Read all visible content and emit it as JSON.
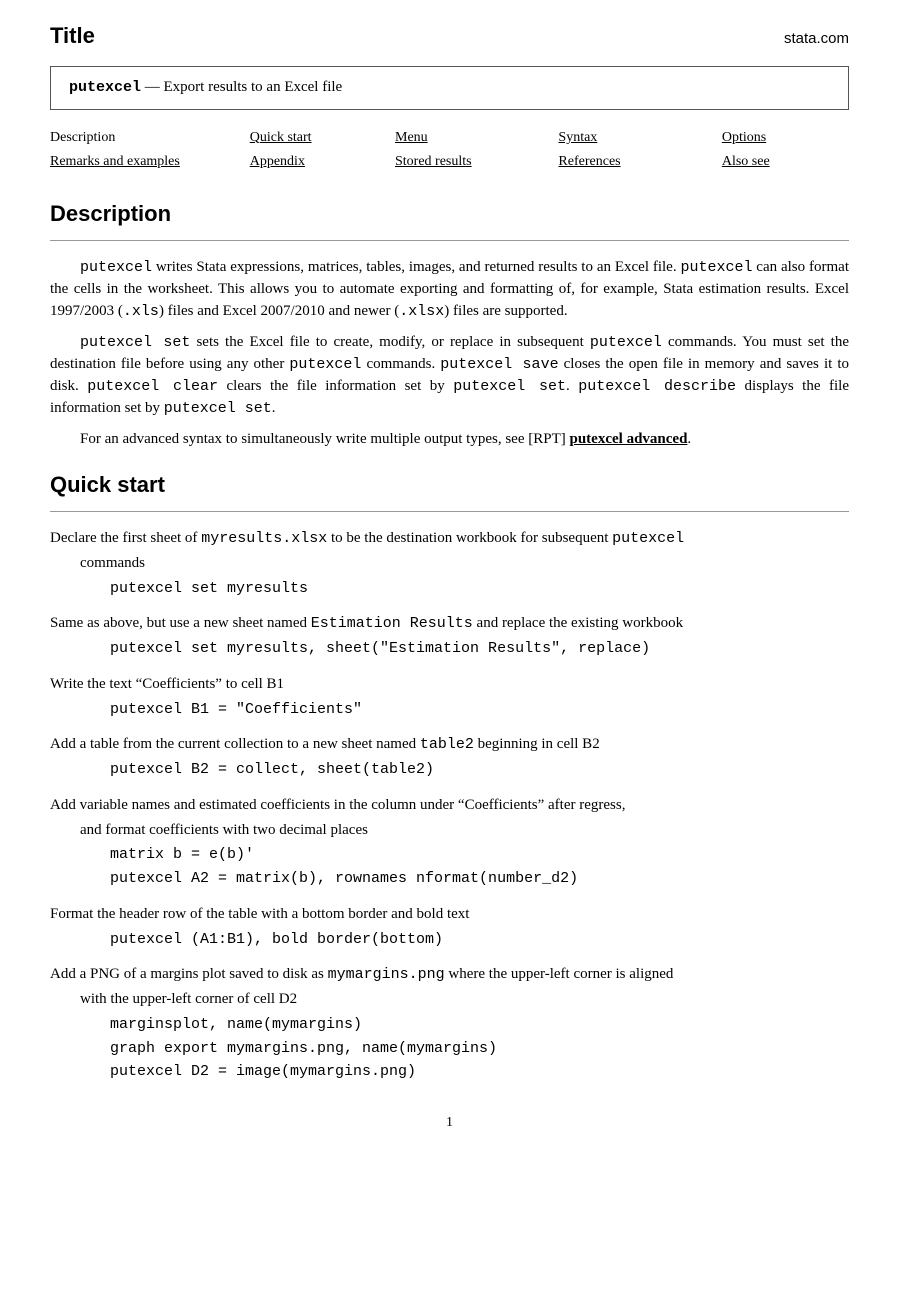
{
  "title": {
    "text": "Title",
    "stata_com": "stata.com"
  },
  "command_box": {
    "command": "putexcel",
    "separator": " — ",
    "description": "Export results to an Excel file"
  },
  "nav": {
    "row1": [
      {
        "label": "Description",
        "link": false
      },
      {
        "label": "Quick start",
        "link": true
      },
      {
        "label": "Menu",
        "link": true
      },
      {
        "label": "Syntax",
        "link": true
      },
      {
        "label": "Options",
        "link": true
      }
    ],
    "row2": [
      {
        "label": "Remarks and examples",
        "link": true
      },
      {
        "label": "Appendix",
        "link": true
      },
      {
        "label": "Stored results",
        "link": true
      },
      {
        "label": "References",
        "link": true
      },
      {
        "label": "Also see",
        "link": true
      }
    ]
  },
  "description_section": {
    "heading": "Description",
    "para1": "putexcel writes Stata expressions, matrices, tables, images, and returned results to an Excel file. putexcel can also format the cells in the worksheet. This allows you to automate exporting and formatting of, for example, Stata estimation results. Excel 1997/2003 (.xls) files and Excel 2007/2010 and newer (.xlsx) files are supported.",
    "para2_prefix": "putexcel set sets the Excel file to create, modify, or replace in subsequent putexcel commands. You must set the destination file before using any other putexcel commands. putexcel save closes the open file in memory and saves it to disk. putexcel clear clears the file information set by putexcel set. putexcel describe displays the file information set by putexcel set.",
    "para3_prefix": "For an advanced syntax to simultaneously write multiple output types, see [RPT] ",
    "para3_link": "putexcel advanced",
    "para3_suffix": "."
  },
  "quickstart_section": {
    "heading": "Quick start",
    "items": [
      {
        "desc": "Declare the first sheet of myresults.xlsx to be the destination workbook for subsequent putexcel commands",
        "desc_cont": null,
        "codes": [
          "putexcel set myresults"
        ]
      },
      {
        "desc": "Same as above, but use a new sheet named Estimation Results and replace the existing workbook",
        "desc_cont": null,
        "codes": [
          "putexcel set myresults, sheet(\"Estimation Results\", replace)"
        ]
      },
      {
        "desc": "Write the text “Coefficients” to cell B1",
        "desc_cont": null,
        "codes": [
          "putexcel B1 = \"Coefficients\""
        ]
      },
      {
        "desc": "Add a table from the current collection to a new sheet named table2 beginning in cell B2",
        "desc_cont": null,
        "codes": [
          "putexcel B2 = collect, sheet(table2)"
        ]
      },
      {
        "desc": "Add variable names and estimated coefficients in the column under “Coefficients” after regress, and format coefficients with two decimal places",
        "desc_cont": null,
        "codes": [
          "matrix b = e(b)'",
          "putexcel A2 = matrix(b), rownames nformat(number_d2)"
        ]
      },
      {
        "desc": "Format the header row of the table with a bottom border and bold text",
        "desc_cont": null,
        "codes": [
          "putexcel (A1:B1), bold border(bottom)"
        ]
      },
      {
        "desc": "Add a PNG of a margins plot saved to disk as mymargins.png where the upper-left corner is aligned with the upper-left corner of cell D2",
        "desc_cont": null,
        "codes": [
          "marginsplot, name(mymargins)",
          "graph export mymargins.png, name(mymargins)",
          "putexcel D2 = image(mymargins.png)"
        ]
      }
    ]
  },
  "page_number": "1"
}
